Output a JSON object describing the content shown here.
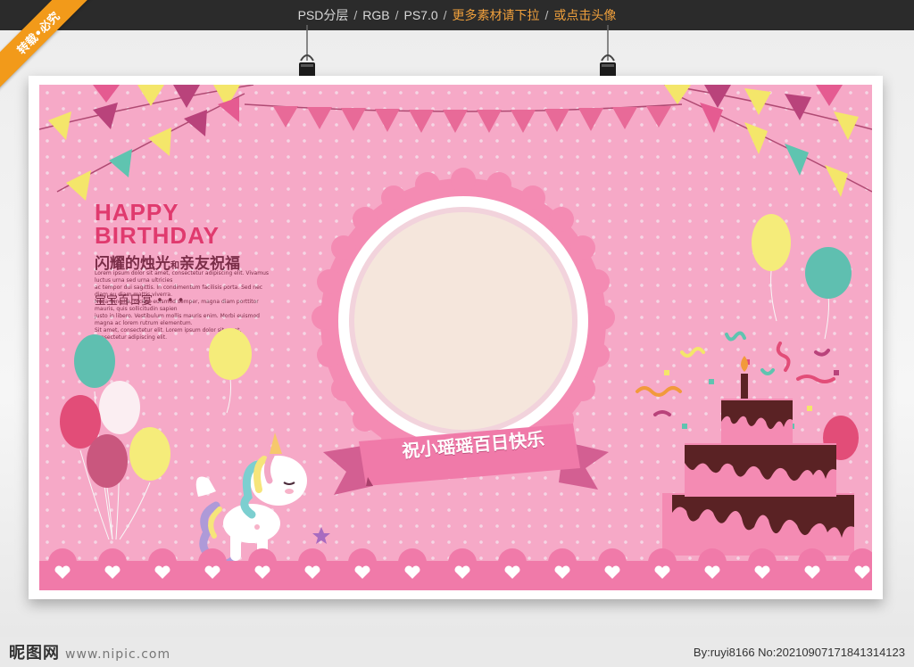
{
  "topbar": {
    "psd": "PSD分层",
    "rgb": "RGB",
    "ps": "PS7.0",
    "more": "更多素材请下拉",
    "or": "或点击头像",
    "sep": "/"
  },
  "corner_ribbon": "转载•必究",
  "poster": {
    "happy": "HAPPY",
    "birthday": "BIRTHDAY",
    "subtitle_a": "闪耀的烛光",
    "subtitle_b": "亲友祝福",
    "subtitle_joiner": "和",
    "lorem_1": "Lorem ipsum dolor sit amet, consectetur adipiscing elit. Vivamus luctus urna sed urna ultricies",
    "lorem_2": "ac tempor dui sagittis. In condimentum facilisis porta. Sed nec diam eu diam mattis viverra.",
    "lorem_3": "Nulla fringilla, orci ac euismod semper, magna diam porttitor mauris, quis sollicitudin sapien",
    "lorem_4": "justo in libero. Vestibulum mollis mauris enim. Morbi euismod magna ac lorem rutrum elementum.",
    "lorem_5": "Sit amet, consectetur elit. Lorem ipsum dolor sit amet, consectetur adipiscing elit.",
    "feast": "宝宝百日宴  • • •",
    "ribbon": "祝小瑶瑶百日快乐"
  },
  "watermark": {
    "logo": "昵图网",
    "site": "www.nipic.com",
    "id": "By:ruyi8166 No:20210907171841314123"
  },
  "colors": {
    "background_pink": "#f6a9c7",
    "accent_pink": "#e03a6e",
    "frame_pink": "#f48bb3",
    "cream": "#f5e6dc",
    "chocolate": "#5a2224"
  }
}
